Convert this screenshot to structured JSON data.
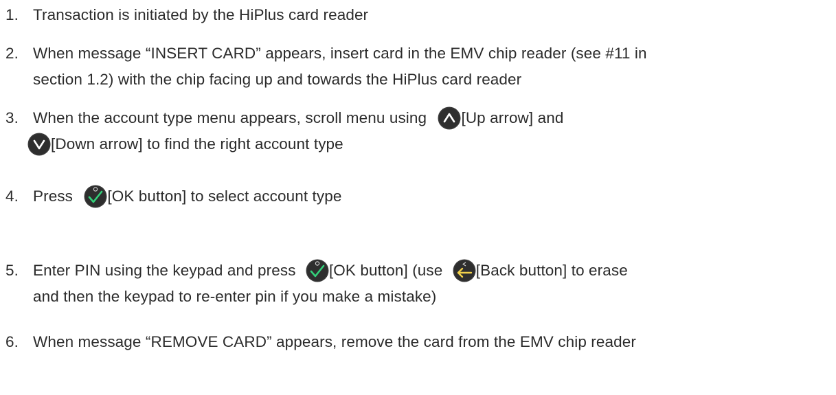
{
  "steps": [
    {
      "number": "1.",
      "lines": [
        "Transaction is initiated by the HiPlus card reader"
      ]
    },
    {
      "number": "2.",
      "lines": [
        "When message “INSERT CARD” appears, insert card in the EMV chip reader (see #11 in",
        "section 1.2)  with the chip facing up and towards the HiPlus card reader"
      ]
    },
    {
      "number": "3.",
      "line1_before": "When the account type menu appears, scroll menu using",
      "line1_after": "[Up arrow] and",
      "line2_after": "[Down arrow] to find the right account type"
    },
    {
      "number": "4.",
      "before": "Press",
      "after": "[OK button] to select account type"
    },
    {
      "number": "5.",
      "line1_before": "Enter PIN using the keypad and press",
      "line1_middle": "[OK button] (use",
      "line1_after": "[Back button] to erase",
      "line2": "and then the keypad to re-enter pin if you make a mistake)"
    },
    {
      "number": "6.",
      "lines": [
        "When message “REMOVE CARD” appears, remove the card from the EMV chip reader"
      ]
    }
  ],
  "icons": {
    "up_arrow": "up-arrow-key",
    "down_arrow": "down-arrow-key",
    "ok": "ok-check-key",
    "back": "back-arrow-key"
  },
  "colors": {
    "text": "#2b2b2b",
    "key_body": "#3a3a3a",
    "ok_check": "#33d17a",
    "back_arrow": "#f2d14b"
  }
}
